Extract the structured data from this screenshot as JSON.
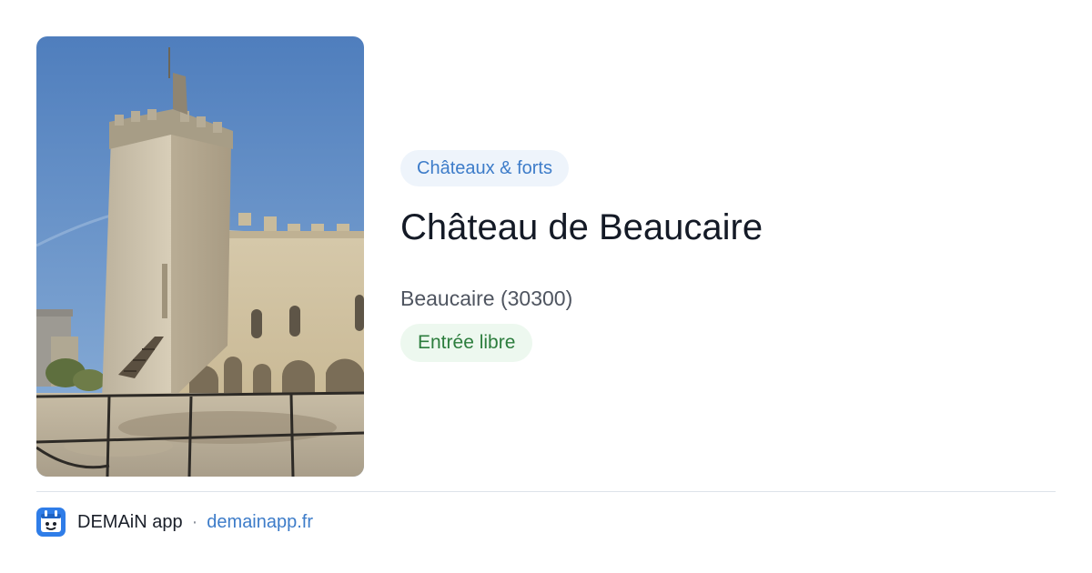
{
  "card": {
    "category": "Châteaux & forts",
    "title": "Château de Beaucaire",
    "location": "Beaucaire (30300)",
    "access": "Entrée libre"
  },
  "footer": {
    "app_name": "DEMAiN app",
    "separator": "·",
    "url": "demainapp.fr"
  },
  "colors": {
    "accent_blue": "#3d7cc9",
    "category_bg": "#eef4fb",
    "access_green": "#2c7d3d",
    "access_bg": "#edf8ef",
    "title": "#141a26"
  },
  "icons": {
    "app_logo": "demain-app-logo-icon"
  }
}
